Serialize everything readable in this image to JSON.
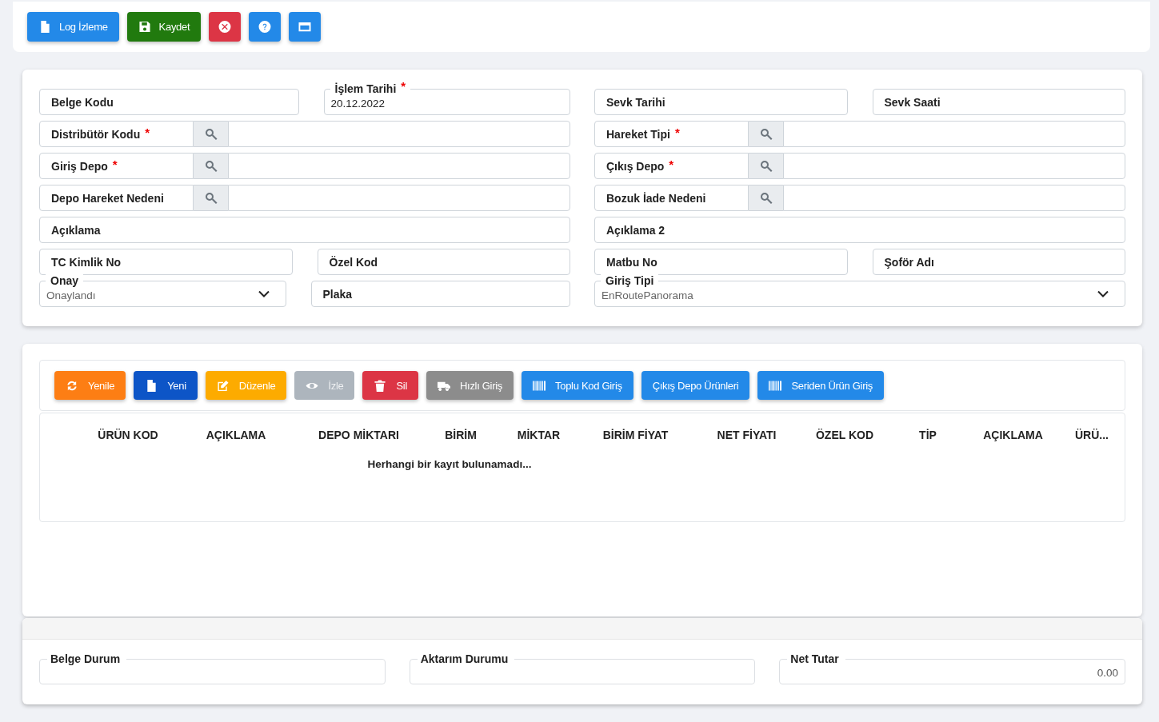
{
  "toolbar": {
    "buttons": [
      {
        "label": "Log İzleme",
        "color": "#2389e8"
      },
      {
        "label": "Kaydet",
        "color": "#217a0e"
      },
      {
        "color": "#dc3545"
      },
      {
        "color": "#2389e8"
      },
      {
        "color": "#2389e8"
      }
    ]
  },
  "form": {
    "columns": [
      {
        "rows": [
          [
            {
              "kind": "text",
              "label": "Belge Kodu"
            },
            {
              "kind": "floating",
              "label": "İşlem Tarihi",
              "required_mark": "*",
              "value": "20.12.2022"
            }
          ],
          [
            {
              "kind": "lookup",
              "label": "Distribütör Kodu",
              "required_mark": "*"
            }
          ],
          [
            {
              "kind": "lookup",
              "label": "Giriş Depo",
              "required_mark": "*"
            }
          ],
          [
            {
              "kind": "lookup",
              "label": "Depo Hareket Nedeni"
            }
          ],
          [
            {
              "kind": "text",
              "label": "Açıklama"
            }
          ],
          [
            {
              "kind": "text",
              "label": "TC Kimlik No"
            },
            {
              "kind": "text",
              "label": "Özel Kod"
            }
          ],
          [
            {
              "kind": "select",
              "label": "Onay",
              "value": "Onaylandı"
            },
            {
              "kind": "text",
              "label": "Plaka"
            }
          ]
        ]
      },
      {
        "rows": [
          [
            {
              "kind": "text",
              "label": "Sevk Tarihi"
            },
            {
              "kind": "text",
              "label": "Sevk Saati"
            }
          ],
          [
            {
              "kind": "lookup",
              "label": "Hareket Tipi",
              "required_mark": "*"
            }
          ],
          [
            {
              "kind": "lookup",
              "label": "Çıkış Depo",
              "required_mark": "*"
            }
          ],
          [
            {
              "kind": "lookup",
              "label": "Bozuk İade Nedeni"
            }
          ],
          [
            {
              "kind": "text",
              "label": "Açıklama 2"
            }
          ],
          [
            {
              "kind": "text",
              "label": "Matbu No"
            },
            {
              "kind": "text",
              "label": "Şoför Adı"
            }
          ],
          [
            {
              "kind": "select",
              "label": "Giriş Tipi",
              "value": "EnRoutePanorama"
            }
          ]
        ]
      }
    ]
  },
  "grid": {
    "buttons": [
      {
        "label": "Yenile",
        "color": "#fd7e14",
        "disabled": false
      },
      {
        "label": "Yeni",
        "color": "#0d55c7",
        "disabled": false
      },
      {
        "label": "Düzenle",
        "color": "#fdab00",
        "disabled": false
      },
      {
        "label": "İzle",
        "color": "#adb5bd",
        "disabled": true
      },
      {
        "label": "Sil",
        "color": "#dc3545",
        "disabled": false
      },
      {
        "label": "Hızlı Giriş",
        "color": "#8c8c8c",
        "disabled": false
      },
      {
        "label": "Toplu Kod Giriş",
        "color": "#2389e8",
        "disabled": false
      },
      {
        "label": "Çıkış Depo Ürünleri",
        "color": "#2389e8",
        "disabled": false
      },
      {
        "label": "Seriden Ürün Giriş",
        "color": "#2389e8",
        "disabled": false
      }
    ],
    "table": {
      "columns": [
        "ÜRÜN KOD",
        "AÇIKLAMA",
        "DEPO MİKTARI",
        "BİRİM",
        "MİKTAR",
        "BİRİM FİYAT",
        "NET FİYATI",
        "ÖZEL KOD",
        "TİP",
        "AÇIKLAMA",
        "ÜRÜ..."
      ],
      "empty_message": "Herhangi bir kayıt bulunamadı..."
    }
  },
  "footer": {
    "fields": [
      {
        "label": "Belge Durum"
      },
      {
        "label": "Aktarım Durumu"
      },
      {
        "label": "Net Tutar",
        "value": "0.00"
      }
    ]
  }
}
